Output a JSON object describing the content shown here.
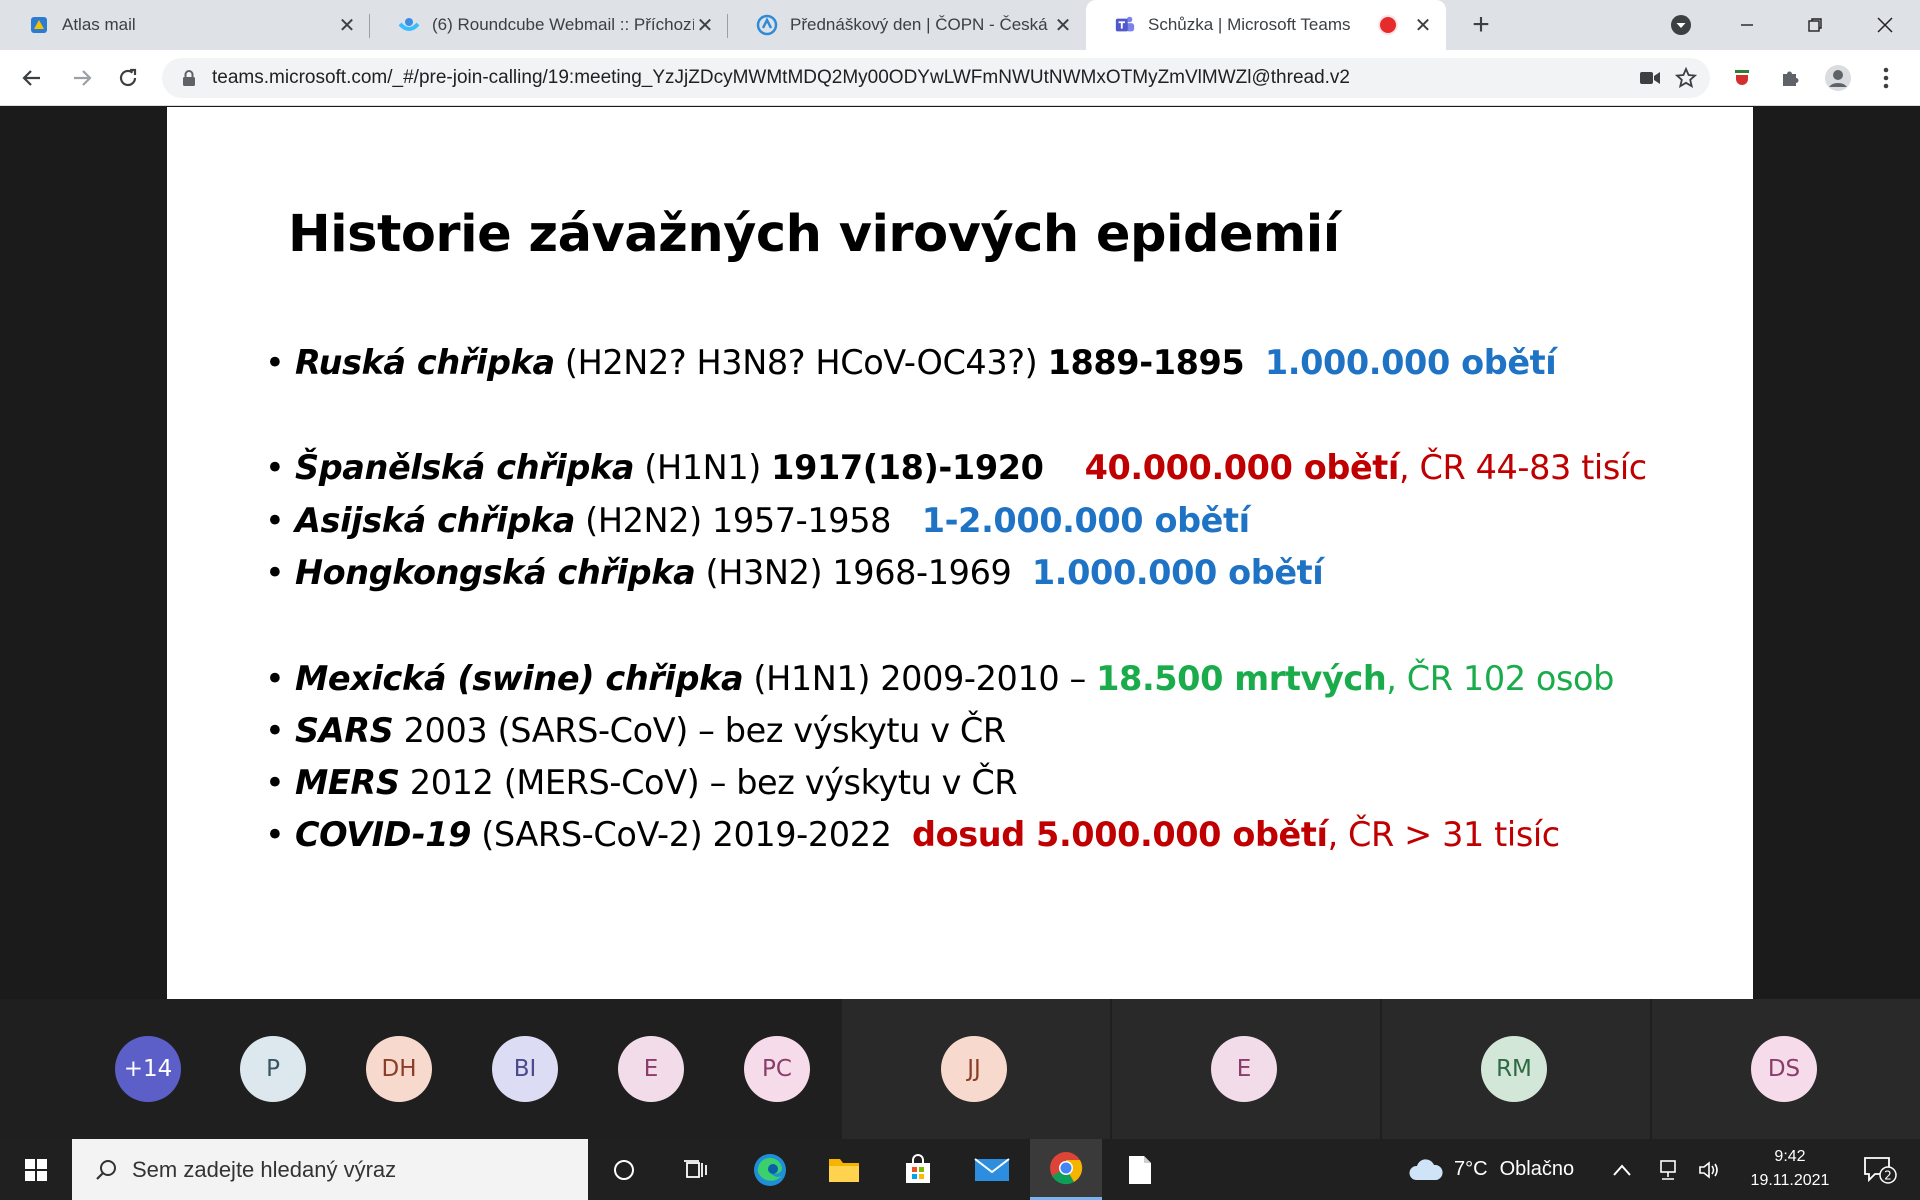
{
  "browser": {
    "tabs": [
      {
        "title": "Atlas mail",
        "icon": "atlas-icon"
      },
      {
        "title": "(6) Roundcube Webmail :: Příchozí",
        "icon": "roundcube-icon"
      },
      {
        "title": "Přednáškový den | ČOPN - Česká",
        "icon": "copn-icon"
      },
      {
        "title": "Schůzka | Microsoft Teams",
        "icon": "teams-icon"
      }
    ],
    "url": "teams.microsoft.com/_#/pre-join-calling/19:meeting_YzJjZDcyMWMtMDQ2My00ODYwLWFmNWUtNWMxOTMyZmVlMWZl@thread.v2"
  },
  "slide": {
    "title": "Historie závažných virových epidemií",
    "bullet_char": "•",
    "items": [
      {
        "name": "Ruská chřipka",
        "strain": " (H2N2? H3N8? HCoV-OC43?) ",
        "years": "1889-1895",
        "gap": "  ",
        "victims": "1.000.000 obětí"
      },
      {
        "name": "Španělská chřipka",
        "strain": " (H1N1) ",
        "years": "1917(18)-1920",
        "gap": "    ",
        "victims": "40.000.000 obětí",
        "extra": ", ČR 44-83 tisíc"
      },
      {
        "name": "Asijská chřipka",
        "strain": " (H2N2) 1957-1958   ",
        "victims": "1-2.000.000 obětí"
      },
      {
        "name": "Hongkongská chřipka",
        "strain": " (H3N2) 1968-1969  ",
        "victims": "1.000.000 obětí"
      },
      {
        "name": "Mexická (swine) chřipka",
        "strain": " (H1N1) 2009-2010 – ",
        "victims": "18.500 mrtvých",
        "extra": ", ČR 102 osob"
      },
      {
        "name": "SARS",
        "rest": " 2003 (SARS-CoV) – bez výskytu v ČR"
      },
      {
        "name": "MERS",
        "rest": " 2012 (MERS-CoV) – bez výskytu v ČR"
      },
      {
        "name": "COVID-19",
        "strain": " (SARS-CoV-2) 2019-2022  ",
        "victims": "dosud 5.000.000 obětí",
        "extra": ", ČR > 31 tisíc"
      }
    ]
  },
  "participants": [
    {
      "initials": "+14",
      "bg": "#5b5fc7",
      "fg": "#ffffff"
    },
    {
      "initials": "P",
      "bg": "#dce8ee",
      "fg": "#3b5560"
    },
    {
      "initials": "DH",
      "bg": "#f7dacd",
      "fg": "#8a3e2a"
    },
    {
      "initials": "BI",
      "bg": "#dcdcf4",
      "fg": "#4a4a8c"
    },
    {
      "initials": "E",
      "bg": "#f2dcea",
      "fg": "#8a3c6a"
    },
    {
      "initials": "PC",
      "bg": "#f6dcea",
      "fg": "#8a3c6a"
    },
    {
      "initials": "JJ",
      "bg": "#f7dacd",
      "fg": "#8a3e2a"
    },
    {
      "initials": "E",
      "bg": "#f2dcea",
      "fg": "#8a3c6a"
    },
    {
      "initials": "RM",
      "bg": "#d3e7d9",
      "fg": "#2f6a44"
    },
    {
      "initials": "DS",
      "bg": "#f6dcea",
      "fg": "#8a3c6a"
    }
  ],
  "taskbar": {
    "search_placeholder": "Sem zadejte hledaný výraz",
    "weather_temp": "7°C",
    "weather_text": "Oblačno",
    "time": "9:42",
    "date": "19.11.2021",
    "notification_count": "2"
  }
}
